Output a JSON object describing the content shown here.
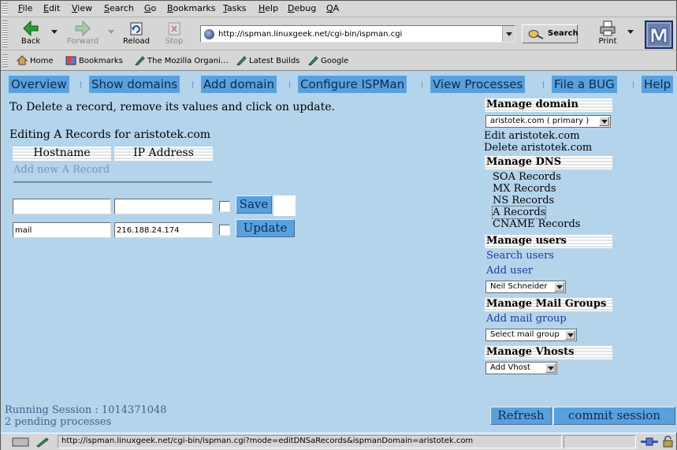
{
  "menubar": {
    "items": [
      "File",
      "Edit",
      "View",
      "Search",
      "Go",
      "Bookmarks",
      "Tasks",
      "Help",
      "Debug",
      "QA"
    ]
  },
  "toolbar": {
    "back_label": "Back",
    "forward_label": "Forward",
    "reload_label": "Reload",
    "stop_label": "Stop",
    "url": "http://ispman.linuxgeek.net/cgi-bin/ispman.cgi",
    "search_label": "Search",
    "print_label": "Print"
  },
  "personal_toolbar": {
    "items": [
      "Home",
      "Bookmarks",
      "The Mozilla Organi…",
      "Latest Builds",
      "Google"
    ]
  },
  "topnav": {
    "items": [
      "Overview",
      "Show domains",
      "Add domain",
      "Configure ISPMan",
      "View Processes",
      "File a BUG",
      "Help"
    ]
  },
  "main": {
    "intro": "To Delete a record, remove its values and click on update.",
    "title": "Editing A Records for aristotek.com",
    "col_hostname": "Hostname",
    "col_ip": "IP Address",
    "add_new": "Add new A Record",
    "new_hostname": "",
    "new_ip": "",
    "save_label": "Save",
    "record_hostname": "mail",
    "record_ip": "216.188.24.174",
    "update_label": "Update"
  },
  "sidebar": {
    "manage_domain": "Manage domain",
    "domain_select": "aristotek.com ( primary )",
    "edit_domain": "Edit aristotek.com",
    "delete_domain": "Delete aristotek.com",
    "manage_dns": "Manage DNS",
    "dns_items": [
      "SOA Records",
      "MX Records",
      "NS Records",
      "A Records",
      "CNAME Records"
    ],
    "manage_users": "Manage users",
    "search_users": "Search users",
    "add_user": "Add user",
    "user_select": "Neil Schneider",
    "manage_mailgroups": "Manage Mail Groups",
    "add_mailgroup": "Add mail group",
    "mailgroup_select": "Select mail group",
    "manage_vhosts": "Manage Vhosts",
    "vhost_select": "Add Vhost"
  },
  "footer": {
    "session": "Running Session : 1014371048",
    "pending": "2 pending processes",
    "refresh_label": "Refresh",
    "commit_label": "commit session"
  },
  "statusbar": {
    "text": "http://ispman.linuxgeek.net/cgi-bin/ispman.cgi?mode=editDNSaRecords&ispmanDomain=aristotek.com"
  }
}
